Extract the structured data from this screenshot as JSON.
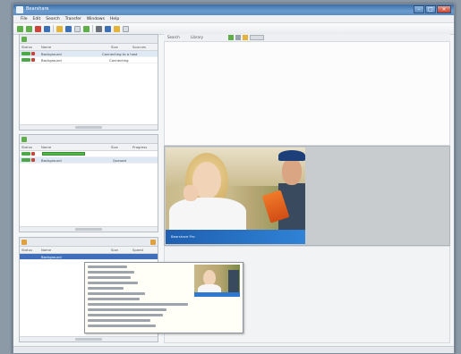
{
  "window": {
    "title": "Bearshare"
  },
  "menubar": [
    "File",
    "Edit",
    "Search",
    "Transfer",
    "Windows",
    "Help"
  ],
  "toolbar": {
    "icons": [
      "back-icon",
      "forward-icon",
      "stop-icon",
      "refresh-icon",
      "home-icon",
      "search-icon",
      "download-icon",
      "upload-icon",
      "library-icon",
      "chat-icon",
      "settings-icon",
      "help-icon"
    ]
  },
  "panes": {
    "search": {
      "columns": [
        "Status",
        "Name",
        "Size",
        "Sources"
      ],
      "rows": [
        {
          "name": "Background",
          "size": "",
          "sources": "Connecting to a host"
        },
        {
          "name": "Background",
          "size": "",
          "sources": "Connecting"
        }
      ]
    },
    "downloads": {
      "columns": [
        "Status",
        "Name",
        "Size",
        "Progress"
      ],
      "rows": [
        {
          "name": "",
          "size": "",
          "progress": 0.6,
          "status": "Downloading"
        },
        {
          "name": "Background",
          "size": "",
          "status": "Queued"
        }
      ]
    },
    "uploads": {
      "columns": [
        "Status",
        "Name",
        "Size",
        "Speed"
      ],
      "rows": [
        {
          "name": "Background",
          "selected": true
        }
      ]
    }
  },
  "right_tabs": [
    "Search",
    "Library"
  ],
  "ad": {
    "banner_text": "Bearshare Pro"
  },
  "statusbar": {
    "left": "",
    "right": ""
  }
}
